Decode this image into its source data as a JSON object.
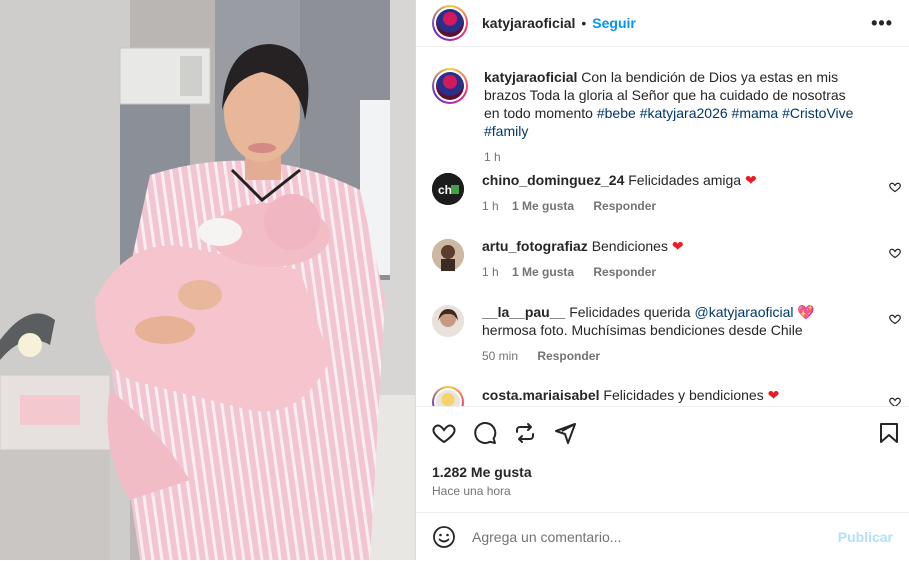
{
  "post": {
    "username": "katyjaraoficial",
    "dot": "•",
    "follow_label": "Seguir",
    "more_label": "•••"
  },
  "caption": {
    "username": "katyjaraoficial",
    "text": "Con la bendición de Dios ya estas en mis brazos Toda la gloria al Señor que ha cuidado de nosotras en todo momento",
    "hashtags": [
      "#bebe",
      "#katyjara2026",
      "#mama",
      "#CristoVive",
      "#family"
    ],
    "time": "1 h"
  },
  "comments": [
    {
      "username": "chino_dominguez_24",
      "text": "Felicidades amiga",
      "emoji": "❤",
      "time": "1 h",
      "likes": "1 Me gusta",
      "reply": "Responder"
    },
    {
      "username": "artu_fotografiaz",
      "text": "Bendiciones",
      "emoji": "❤",
      "time": "1 h",
      "likes": "1 Me gusta",
      "reply": "Responder"
    },
    {
      "username": "__la__pau__",
      "text_before": "Felicidades querida",
      "mention": "@katyjaraoficial",
      "emoji": "💖",
      "text_after": "hermosa foto. Muchísimas bendiciones desde Chile",
      "time": "50 min",
      "reply": "Responder"
    },
    {
      "username": "costa.mariaisabel",
      "text": "Felicidades y bendiciones",
      "emoji": "❤"
    }
  ],
  "stats": {
    "likes": "1.282 Me gusta",
    "time_ago": "Hace una hora"
  },
  "add_comment": {
    "placeholder": "Agrega un comentario...",
    "publish": "Publicar"
  },
  "colors": {
    "accent": "#0095f6",
    "publish_disabled": "#b2dffc",
    "secondary_text": "#737373",
    "heart_emoji": "#ed1c24"
  }
}
